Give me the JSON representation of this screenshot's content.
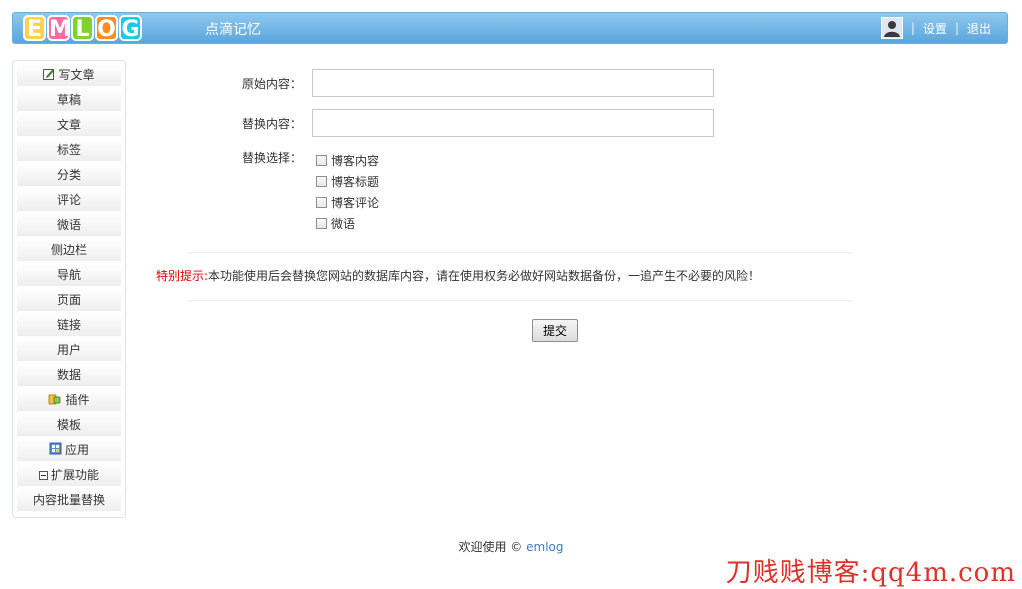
{
  "header": {
    "logo_letters": [
      "E",
      "M",
      "L",
      "O",
      "G"
    ],
    "logo_colors": [
      "#ffd24a",
      "#ff6aa5",
      "#7fd32e",
      "#ff8c21",
      "#21c7e8"
    ],
    "site_name": "点滴记忆",
    "separator": "|",
    "settings_label": "设置",
    "logout_label": "退出"
  },
  "sidebar": {
    "items": [
      {
        "label": "写文章",
        "icon": "edit-icon"
      },
      {
        "label": "草稿"
      },
      {
        "label": "文章"
      },
      {
        "label": "标签"
      },
      {
        "label": "分类"
      },
      {
        "label": "评论"
      },
      {
        "label": "微语"
      },
      {
        "label": "侧边栏"
      },
      {
        "label": "导航"
      },
      {
        "label": "页面"
      },
      {
        "label": "链接"
      },
      {
        "label": "用户"
      },
      {
        "label": "数据"
      },
      {
        "label": "插件",
        "icon": "plugin-icon"
      },
      {
        "label": "模板"
      },
      {
        "label": "应用",
        "icon": "app-icon"
      },
      {
        "label": "扩展功能",
        "icon": "collapse-icon"
      },
      {
        "label": "内容批量替换"
      }
    ]
  },
  "form": {
    "original_label": "原始内容：",
    "original_value": "",
    "replace_label": "替换内容：",
    "replace_value": "",
    "options_label": "替换选择：",
    "options": [
      {
        "label": "博客内容",
        "checked": false
      },
      {
        "label": "博客标题",
        "checked": false
      },
      {
        "label": "博客评论",
        "checked": false
      },
      {
        "label": "微语",
        "checked": false
      }
    ],
    "tip_highlight": "特别提示:",
    "tip_text": "本功能使用后会替换您网站的数据库内容，请在使用权务必做好网站数据备份，一追产生不必要的风险！",
    "submit_label": "提交"
  },
  "footer": {
    "text": "欢迎使用 © ",
    "link": "emlog"
  },
  "watermark": "刀贱贱博客:qq4m.com"
}
